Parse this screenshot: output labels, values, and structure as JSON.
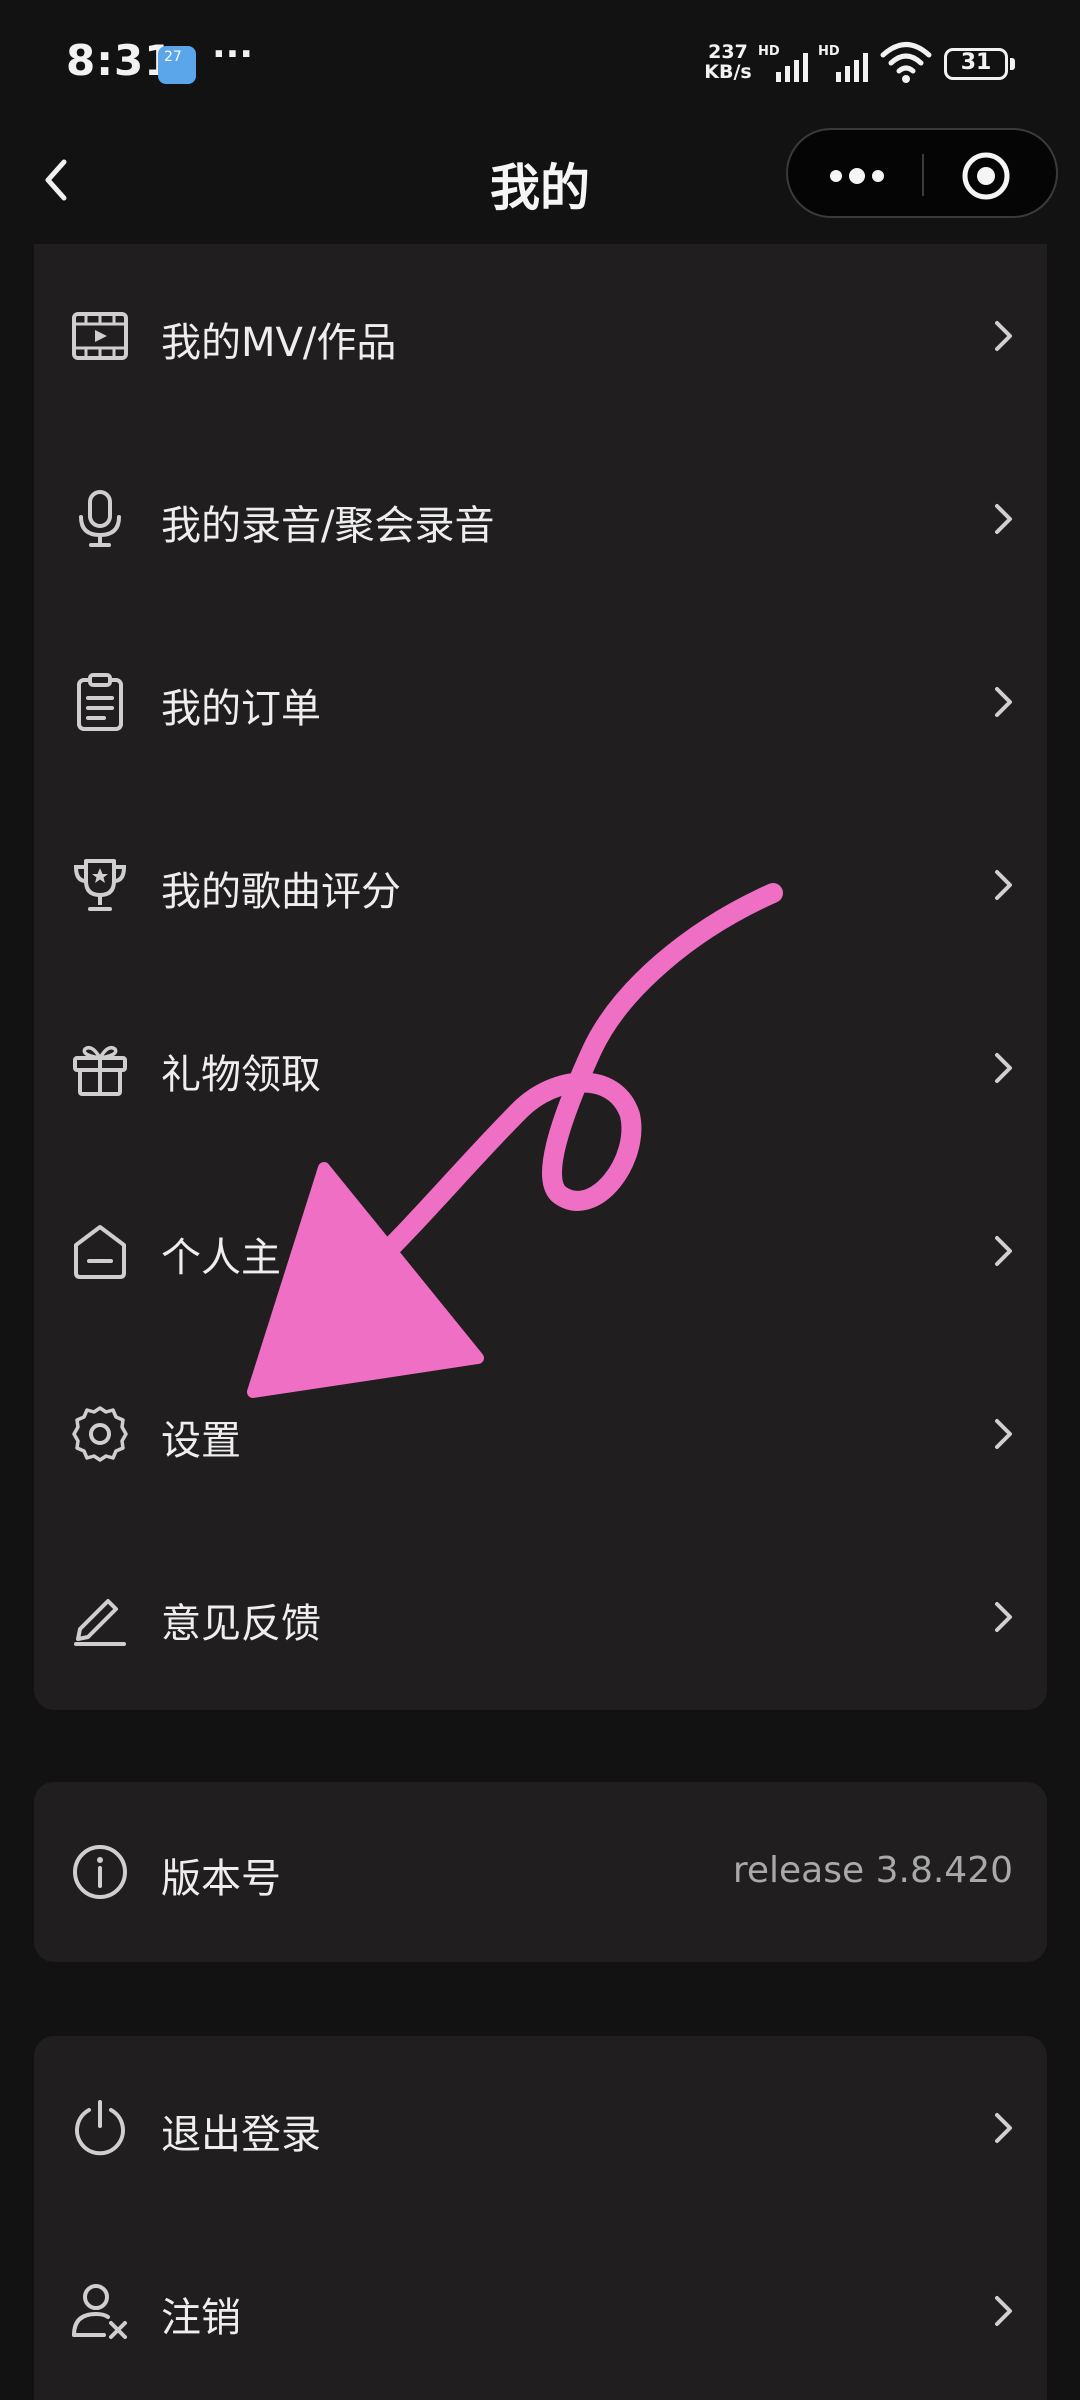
{
  "status_bar": {
    "time": "8:31",
    "weather_badge": "27",
    "more_dots": "···",
    "net_speed_value": "237",
    "net_speed_unit": "KB/s",
    "signal_1_label": "HD",
    "signal_2_label": "HD",
    "battery": "31"
  },
  "nav": {
    "title": "我的"
  },
  "menu": [
    {
      "label": "我的MV/作品",
      "icon": "film-icon"
    },
    {
      "label": "我的录音/聚会录音",
      "icon": "microphone-icon"
    },
    {
      "label": "我的订单",
      "icon": "clipboard-icon"
    },
    {
      "label": "我的歌曲评分",
      "icon": "trophy-icon"
    },
    {
      "label": "礼物领取",
      "icon": "gift-icon"
    },
    {
      "label": "个人主",
      "icon": "home-icon"
    },
    {
      "label": "设置",
      "icon": "gear-icon"
    },
    {
      "label": "意见反馈",
      "icon": "pencil-icon"
    }
  ],
  "version": {
    "label": "版本号",
    "value": "release 3.8.420",
    "icon": "info-icon"
  },
  "account": [
    {
      "label": "退出登录",
      "icon": "power-icon"
    },
    {
      "label": "注销",
      "icon": "user-remove-icon"
    }
  ],
  "colors": {
    "background": "#131213",
    "card": "#201e1f",
    "text": "#eeeeee",
    "secondary_text": "#a9a9a9",
    "annotation_arrow": "#ee6fc4"
  }
}
